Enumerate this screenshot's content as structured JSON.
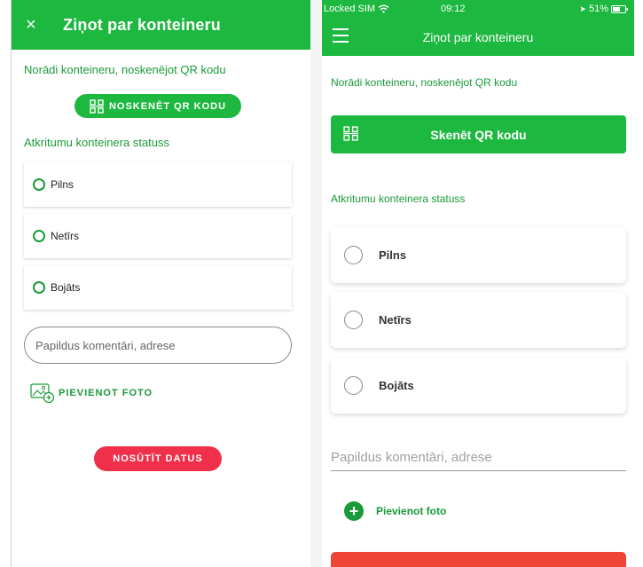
{
  "android": {
    "close_icon": "×",
    "title": "Ziņot par konteineru",
    "qr_label": "Norādi konteineru, noskenējot QR kodu",
    "scan_button": "NOSKENĒT QR KODU",
    "status_label": "Atkritumu konteinera statuss",
    "options": [
      "Pilns",
      "Netīrs",
      "Bojāts"
    ],
    "comment_placeholder": "Papildus komentāri, adrese",
    "add_photo": "PIEVIENOT FOTO",
    "send_button": "NOSŪTĪT DATUS"
  },
  "ios": {
    "status_bar": {
      "carrier": "Locked SIM",
      "time": "09:12",
      "battery": "51%"
    },
    "title": "Ziņot par konteineru",
    "qr_label": "Norādi konteineru, noskenējot QR kodu",
    "scan_button": "Skenēt QR kodu",
    "status_label": "Atkritumu konteinera statuss",
    "options": [
      "Pilns",
      "Netīrs",
      "Bojāts"
    ],
    "comment_placeholder": "Papildus komentāri, adrese",
    "add_photo": "Pievienot foto"
  },
  "colors": {
    "primary_green": "#1db840",
    "text_green": "#1a9a3a",
    "send_red": "#f0304a"
  }
}
